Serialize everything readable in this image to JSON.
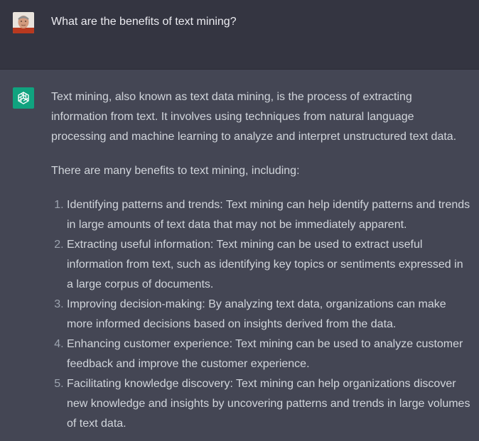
{
  "user_message": {
    "text": "What are the benefits of text mining?"
  },
  "assistant_message": {
    "intro": "Text mining, also known as text data mining, is the process of extracting information from text. It involves using techniques from natural language processing and machine learning to analyze and interpret unstructured text data.",
    "lead": "There are many benefits to text mining, including:",
    "benefits": [
      "Identifying patterns and trends: Text mining can help identify patterns and trends in large amounts of text data that may not be immediately apparent.",
      "Extracting useful information: Text mining can be used to extract useful information from text, such as identifying key topics or sentiments expressed in a large corpus of documents.",
      "Improving decision-making: By analyzing text data, organizations can make more informed decisions based on insights derived from the data.",
      "Enhancing customer experience: Text mining can be used to analyze customer feedback and improve the customer experience.",
      "Facilitating knowledge discovery: Text mining can help organizations discover new knowledge and insights by uncovering patterns and trends in large volumes of text data."
    ]
  },
  "icons": {
    "user": "user-avatar-icon",
    "assistant": "openai-logo-icon"
  },
  "colors": {
    "user_bg": "#343541",
    "assistant_bg": "#444654",
    "brand": "#10a37f",
    "text": "#d1d5db"
  }
}
